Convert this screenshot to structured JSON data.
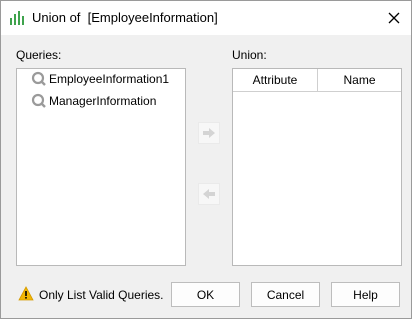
{
  "window": {
    "title": "Union of  [EmployeeInformation]",
    "icon": "chart-bars-icon",
    "close_icon": "close-icon"
  },
  "queries": {
    "label": "Queries:",
    "items": [
      {
        "label": "EmployeeInformation1",
        "icon": "query-icon"
      },
      {
        "label": "ManagerInformation",
        "icon": "query-icon"
      }
    ]
  },
  "arrows": {
    "add_icon": "arrow-right-icon",
    "remove_icon": "arrow-left-icon"
  },
  "union": {
    "label": "Union:",
    "columns": [
      "Attribute",
      "Name"
    ],
    "rows": []
  },
  "footer": {
    "warning_text": "Only List Valid Queries.",
    "warning_icon": "warning-icon",
    "ok_label": "OK",
    "cancel_label": "Cancel",
    "help_label": "Help"
  },
  "colors": {
    "accent_green": "#3fa34d",
    "warning_yellow": "#f2b705",
    "query_icon_gray": "#9a9a9a"
  }
}
